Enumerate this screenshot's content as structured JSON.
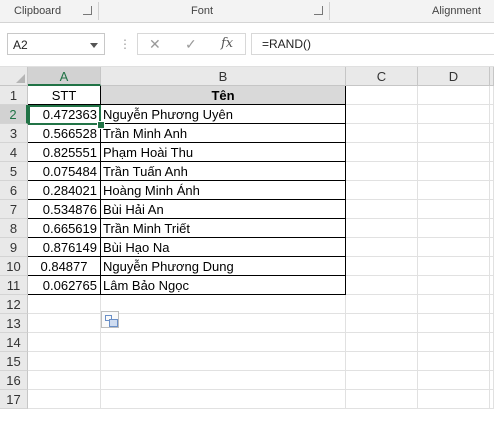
{
  "ribbon": {
    "groups": [
      "Clipboard",
      "Font",
      "Alignment"
    ]
  },
  "formula_bar": {
    "name_box": "A2",
    "dots": "⋮",
    "cancel_icon": "✕",
    "enter_icon": "✓",
    "fx_label": "fx",
    "formula": "=RAND()"
  },
  "columns": [
    "A",
    "B",
    "C",
    "D"
  ],
  "rows": [
    "1",
    "2",
    "3",
    "4",
    "5",
    "6",
    "7",
    "8",
    "9",
    "10",
    "11",
    "12",
    "13",
    "14",
    "15",
    "16",
    "17"
  ],
  "table": {
    "headers": [
      "STT",
      "Tên"
    ],
    "values": [
      "0.472363",
      "0.566528",
      "0.825551",
      "0.075484",
      "0.284021",
      "0.534876",
      "0.665619",
      "0.876149",
      "0.84877",
      "0.062765"
    ],
    "names": [
      "Nguyễn Phương Uyên",
      "Trần Minh Anh",
      "Phạm Hoài Thu",
      "Trần Tuấn Anh",
      "Hoàng Minh Ánh",
      "Bùi Hải An",
      "Trần Minh Triết",
      "Bùi Hạo Na",
      "Nguyễn Phương Dung",
      "Lâm Bảo Ngọc"
    ]
  },
  "colors": {
    "accent": "#217346",
    "header_fill": "#d9d9d9"
  },
  "icons": {
    "launcher": "dialog-launcher-icon",
    "quick_analysis": "quick-analysis-icon"
  }
}
